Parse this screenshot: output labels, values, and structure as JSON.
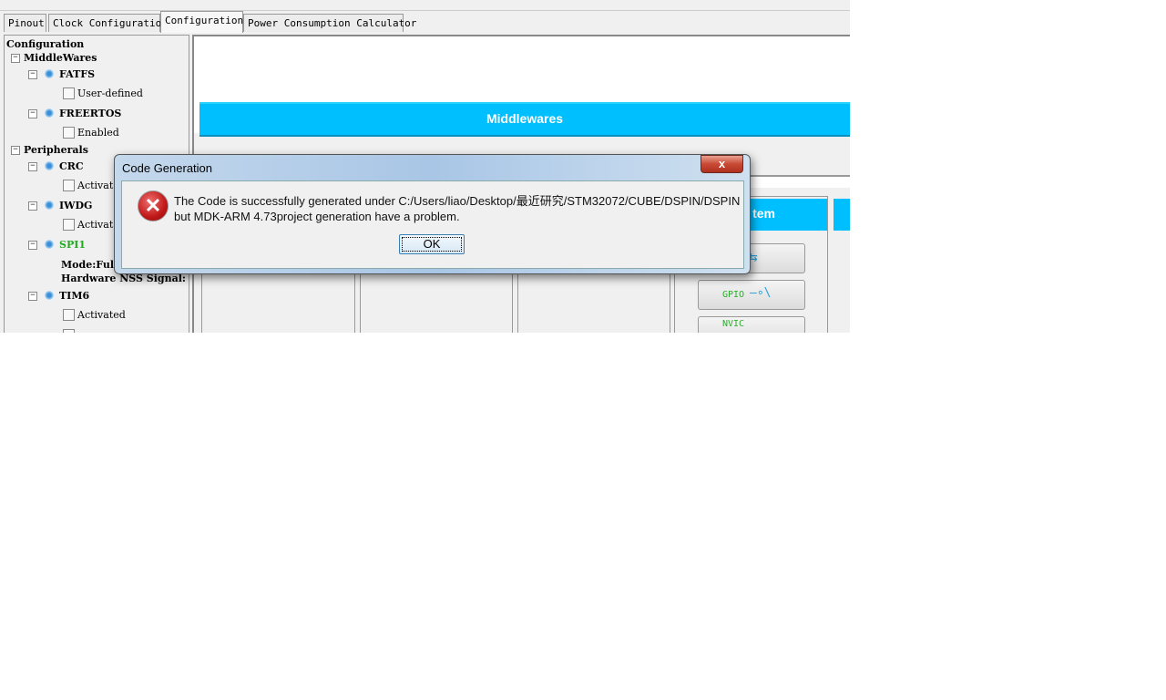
{
  "tabs": [
    {
      "label": "Pinout"
    },
    {
      "label": "Clock Configuration"
    },
    {
      "label": "Configuration"
    },
    {
      "label": "Power Consumption Calculator"
    }
  ],
  "tree": {
    "root": "Configuration",
    "middlewares": "MiddleWares",
    "fatfs": "FATFS",
    "fatfs_opt": "User-defined",
    "freertos": "FREERTOS",
    "freertos_opt": "Enabled",
    "peripherals": "Peripherals",
    "crc": "CRC",
    "crc_opt": "Activat",
    "iwdg": "IWDG",
    "iwdg_opt": "Activat",
    "spi1": "SPI1",
    "spi1_mode": "Mode:Full",
    "spi1_nss": "Hardware NSS Signal:",
    "tim6": "TIM6",
    "tim6_opt": "Activated"
  },
  "main": {
    "banner": "Middlewares",
    "system_header": "tem",
    "buttons": [
      "GPIO",
      "NVIC"
    ]
  },
  "colors": {
    "accent": "#00bfff",
    "spi_green": "#22aa22"
  },
  "dialog": {
    "title": "Code Generation",
    "close": "x",
    "line1": "The Code is successfully generated under C:/Users/liao/Desktop/最近研究/STM32072/CUBE/DSPIN/DSPIN",
    "line2": "but MDK-ARM 4.73project generation have a problem.",
    "ok": "OK",
    "icon": "error-icon"
  }
}
